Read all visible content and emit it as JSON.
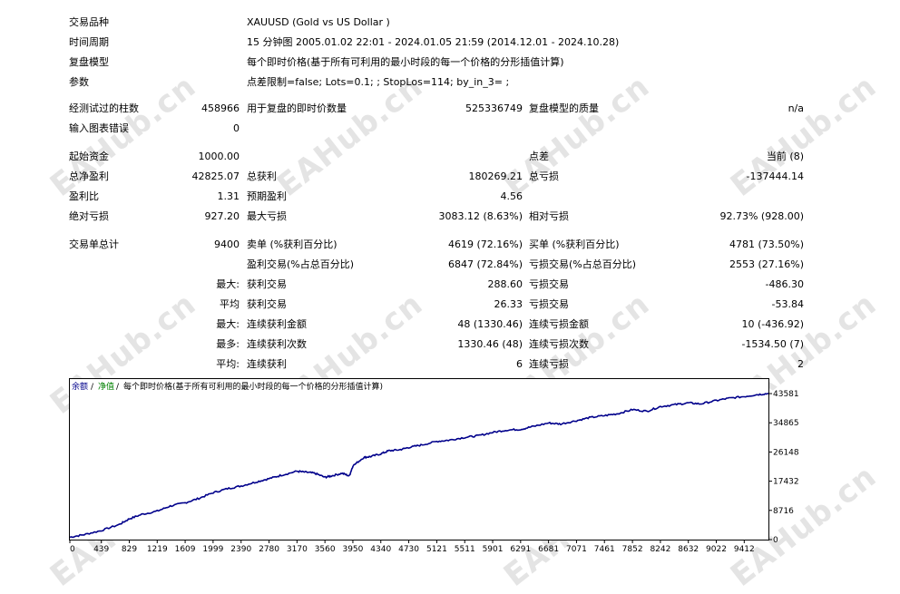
{
  "info": {
    "symbol": {
      "label": "交易品种",
      "value": "XAUUSD (Gold vs US Dollar )"
    },
    "period": {
      "label": "时间周期",
      "value": "15 分钟图 2005.01.02 22:01 - 2024.01.05 21:59 (2014.12.01 - 2024.10.28)"
    },
    "model": {
      "label": "复盘模型",
      "value": "每个即时价格(基于所有可利用的最小时段的每一个价格的分形插值计算)"
    },
    "params": {
      "label": "参数",
      "value": "点差限制=false; Lots=0.1; ; StopLos=114; by_in_3= ;"
    }
  },
  "stats": {
    "bars_label": "经测试过的柱数",
    "bars_value": "458966",
    "ticks_label": "用于复盘的即时价数量",
    "ticks_value": "525336749",
    "quality_label": "复盘模型的质量",
    "quality_value": "n/a",
    "errors_label": "输入图表错误",
    "errors_value": "0",
    "deposit_label": "起始资金",
    "deposit_value": "1000.00",
    "spread_label": "点差",
    "spread_value": "当前 (8)",
    "netprofit_label": "总净盈利",
    "netprofit_value": "42825.07",
    "grossprofit_label": "总获利",
    "grossprofit_value": "180269.21",
    "grossloss_label": "总亏损",
    "grossloss_value": "-137444.14",
    "pf_label": "盈利比",
    "pf_value": "1.31",
    "expected_label": "预期盈利",
    "expected_value": "4.56",
    "absdd_label": "绝对亏损",
    "absdd_value": "927.20",
    "maxdd_label": "最大亏损",
    "maxdd_value": "3083.12 (8.63%)",
    "reldd_label": "相对亏损",
    "reldd_value": "92.73% (928.00)",
    "total_label": "交易单总计",
    "total_value": "9400",
    "short_label": "卖单 (%获利百分比)",
    "short_value": "4619 (72.16%)",
    "long_label": "买单 (%获利百分比)",
    "long_value": "4781 (73.50%)",
    "profit_trades_label": "盈利交易(%占总百分比)",
    "profit_trades_value": "6847 (72.84%)",
    "loss_trades_label": "亏损交易(%占总百分比)",
    "loss_trades_value": "2553 (27.16%)",
    "r1_prefix": "最大:",
    "r1_label": "获利交易",
    "r1_value": "288.60",
    "r1_label2": "亏损交易",
    "r1_value2": "-486.30",
    "r2_prefix": "平均",
    "r2_label": "获利交易",
    "r2_value": "26.33",
    "r2_label2": "亏损交易",
    "r2_value2": "-53.84",
    "r3_prefix": "最大:",
    "r3_label": "连续获利金额",
    "r3_value": "48 (1330.46)",
    "r3_label2": "连续亏损金额",
    "r3_value2": "10 (-436.92)",
    "r4_prefix": "最多:",
    "r4_label": "连续获利次数",
    "r4_value": "1330.46 (48)",
    "r4_label2": "连续亏损次数",
    "r4_value2": "-1534.50 (7)",
    "r5_prefix": "平均:",
    "r5_label": "连续获利",
    "r5_value": "6",
    "r5_label2": "连续亏损",
    "r5_value2": "2"
  },
  "watermark": "EAHub.cn",
  "chart_header": {
    "balance": "余额",
    "sep1": "/",
    "equity": "净值",
    "sep2": "/",
    "text": "每个即时价格(基于所有可利用的最小时段的每一个价格的分形插值计算)"
  },
  "chart_data": {
    "type": "line",
    "title": "",
    "xlabel": "",
    "ylabel": "",
    "x_ticks": [
      "0",
      "439",
      "829",
      "1219",
      "1609",
      "1999",
      "2390",
      "2780",
      "3170",
      "3560",
      "3950",
      "4340",
      "4730",
      "5121",
      "5511",
      "5901",
      "6291",
      "6681",
      "7071",
      "7461",
      "7852",
      "8242",
      "8632",
      "9022",
      "9412"
    ],
    "y_ticks": [
      "43581",
      "34865",
      "26148",
      "17432",
      "8716",
      "0"
    ],
    "xlim": [
      0,
      9750
    ],
    "ylim": [
      0,
      43581
    ],
    "series": [
      {
        "color": "#00008b",
        "x": [
          0,
          200,
          439,
          700,
          829,
          1000,
          1219,
          1400,
          1609,
          1800,
          1999,
          2200,
          2390,
          2600,
          2780,
          2950,
          3170,
          3300,
          3420,
          3560,
          3650,
          3800,
          3900,
          3950,
          4100,
          4200,
          4340,
          4450,
          4600,
          4730,
          4900,
          5121,
          5300,
          5511,
          5700,
          5901,
          6100,
          6291,
          6450,
          6681,
          6850,
          7071,
          7250,
          7461,
          7650,
          7852,
          8050,
          8242,
          8450,
          8632,
          8800,
          9022,
          9200,
          9412,
          9600,
          9750
        ],
        "y": [
          700,
          1500,
          2700,
          4600,
          6200,
          7500,
          8500,
          10000,
          11000,
          12300,
          14000,
          15200,
          16000,
          17200,
          18200,
          19200,
          20400,
          20100,
          19800,
          18600,
          19000,
          19800,
          19000,
          22000,
          24500,
          24800,
          25600,
          26500,
          26800,
          27500,
          28200,
          29300,
          29700,
          30500,
          31000,
          32000,
          32700,
          32900,
          33700,
          34800,
          34500,
          35500,
          36400,
          37000,
          37600,
          38800,
          38300,
          39700,
          40300,
          40800,
          40500,
          41500,
          42200,
          42700,
          43300,
          43600
        ]
      }
    ]
  }
}
